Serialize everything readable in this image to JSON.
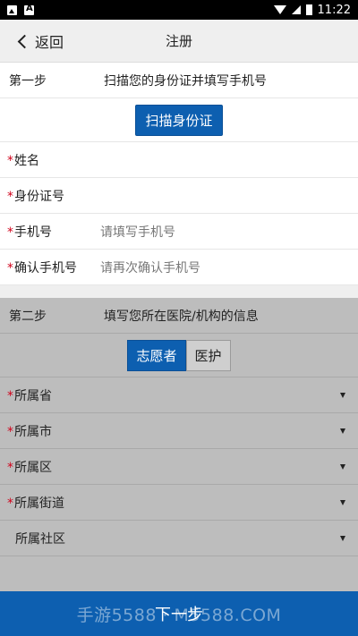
{
  "status": {
    "time": "11:22"
  },
  "header": {
    "back": "返回",
    "title": "注册"
  },
  "step1": {
    "label": "第一步",
    "text": "扫描您的身份证并填写手机号",
    "scan_button": "扫描身份证",
    "fields": [
      {
        "label": "姓名",
        "required": "*",
        "placeholder": ""
      },
      {
        "label": "身份证号",
        "required": "*",
        "placeholder": ""
      },
      {
        "label": "手机号",
        "required": "*",
        "placeholder": "请填写手机号"
      },
      {
        "label": "确认手机号",
        "required": "*",
        "placeholder": "请再次确认手机号"
      }
    ]
  },
  "step2": {
    "label": "第二步",
    "text": "填写您所在医院/机构的信息",
    "roles": [
      "志愿者",
      "医护"
    ],
    "selects": [
      {
        "label": "所属省",
        "required": "*"
      },
      {
        "label": "所属市",
        "required": "*"
      },
      {
        "label": "所属区",
        "required": "*"
      },
      {
        "label": "所属街道",
        "required": "*"
      },
      {
        "label": "所属社区",
        "required": ""
      }
    ]
  },
  "footer": {
    "next": "下一步",
    "watermark": "手游5588 · M5588.COM"
  }
}
